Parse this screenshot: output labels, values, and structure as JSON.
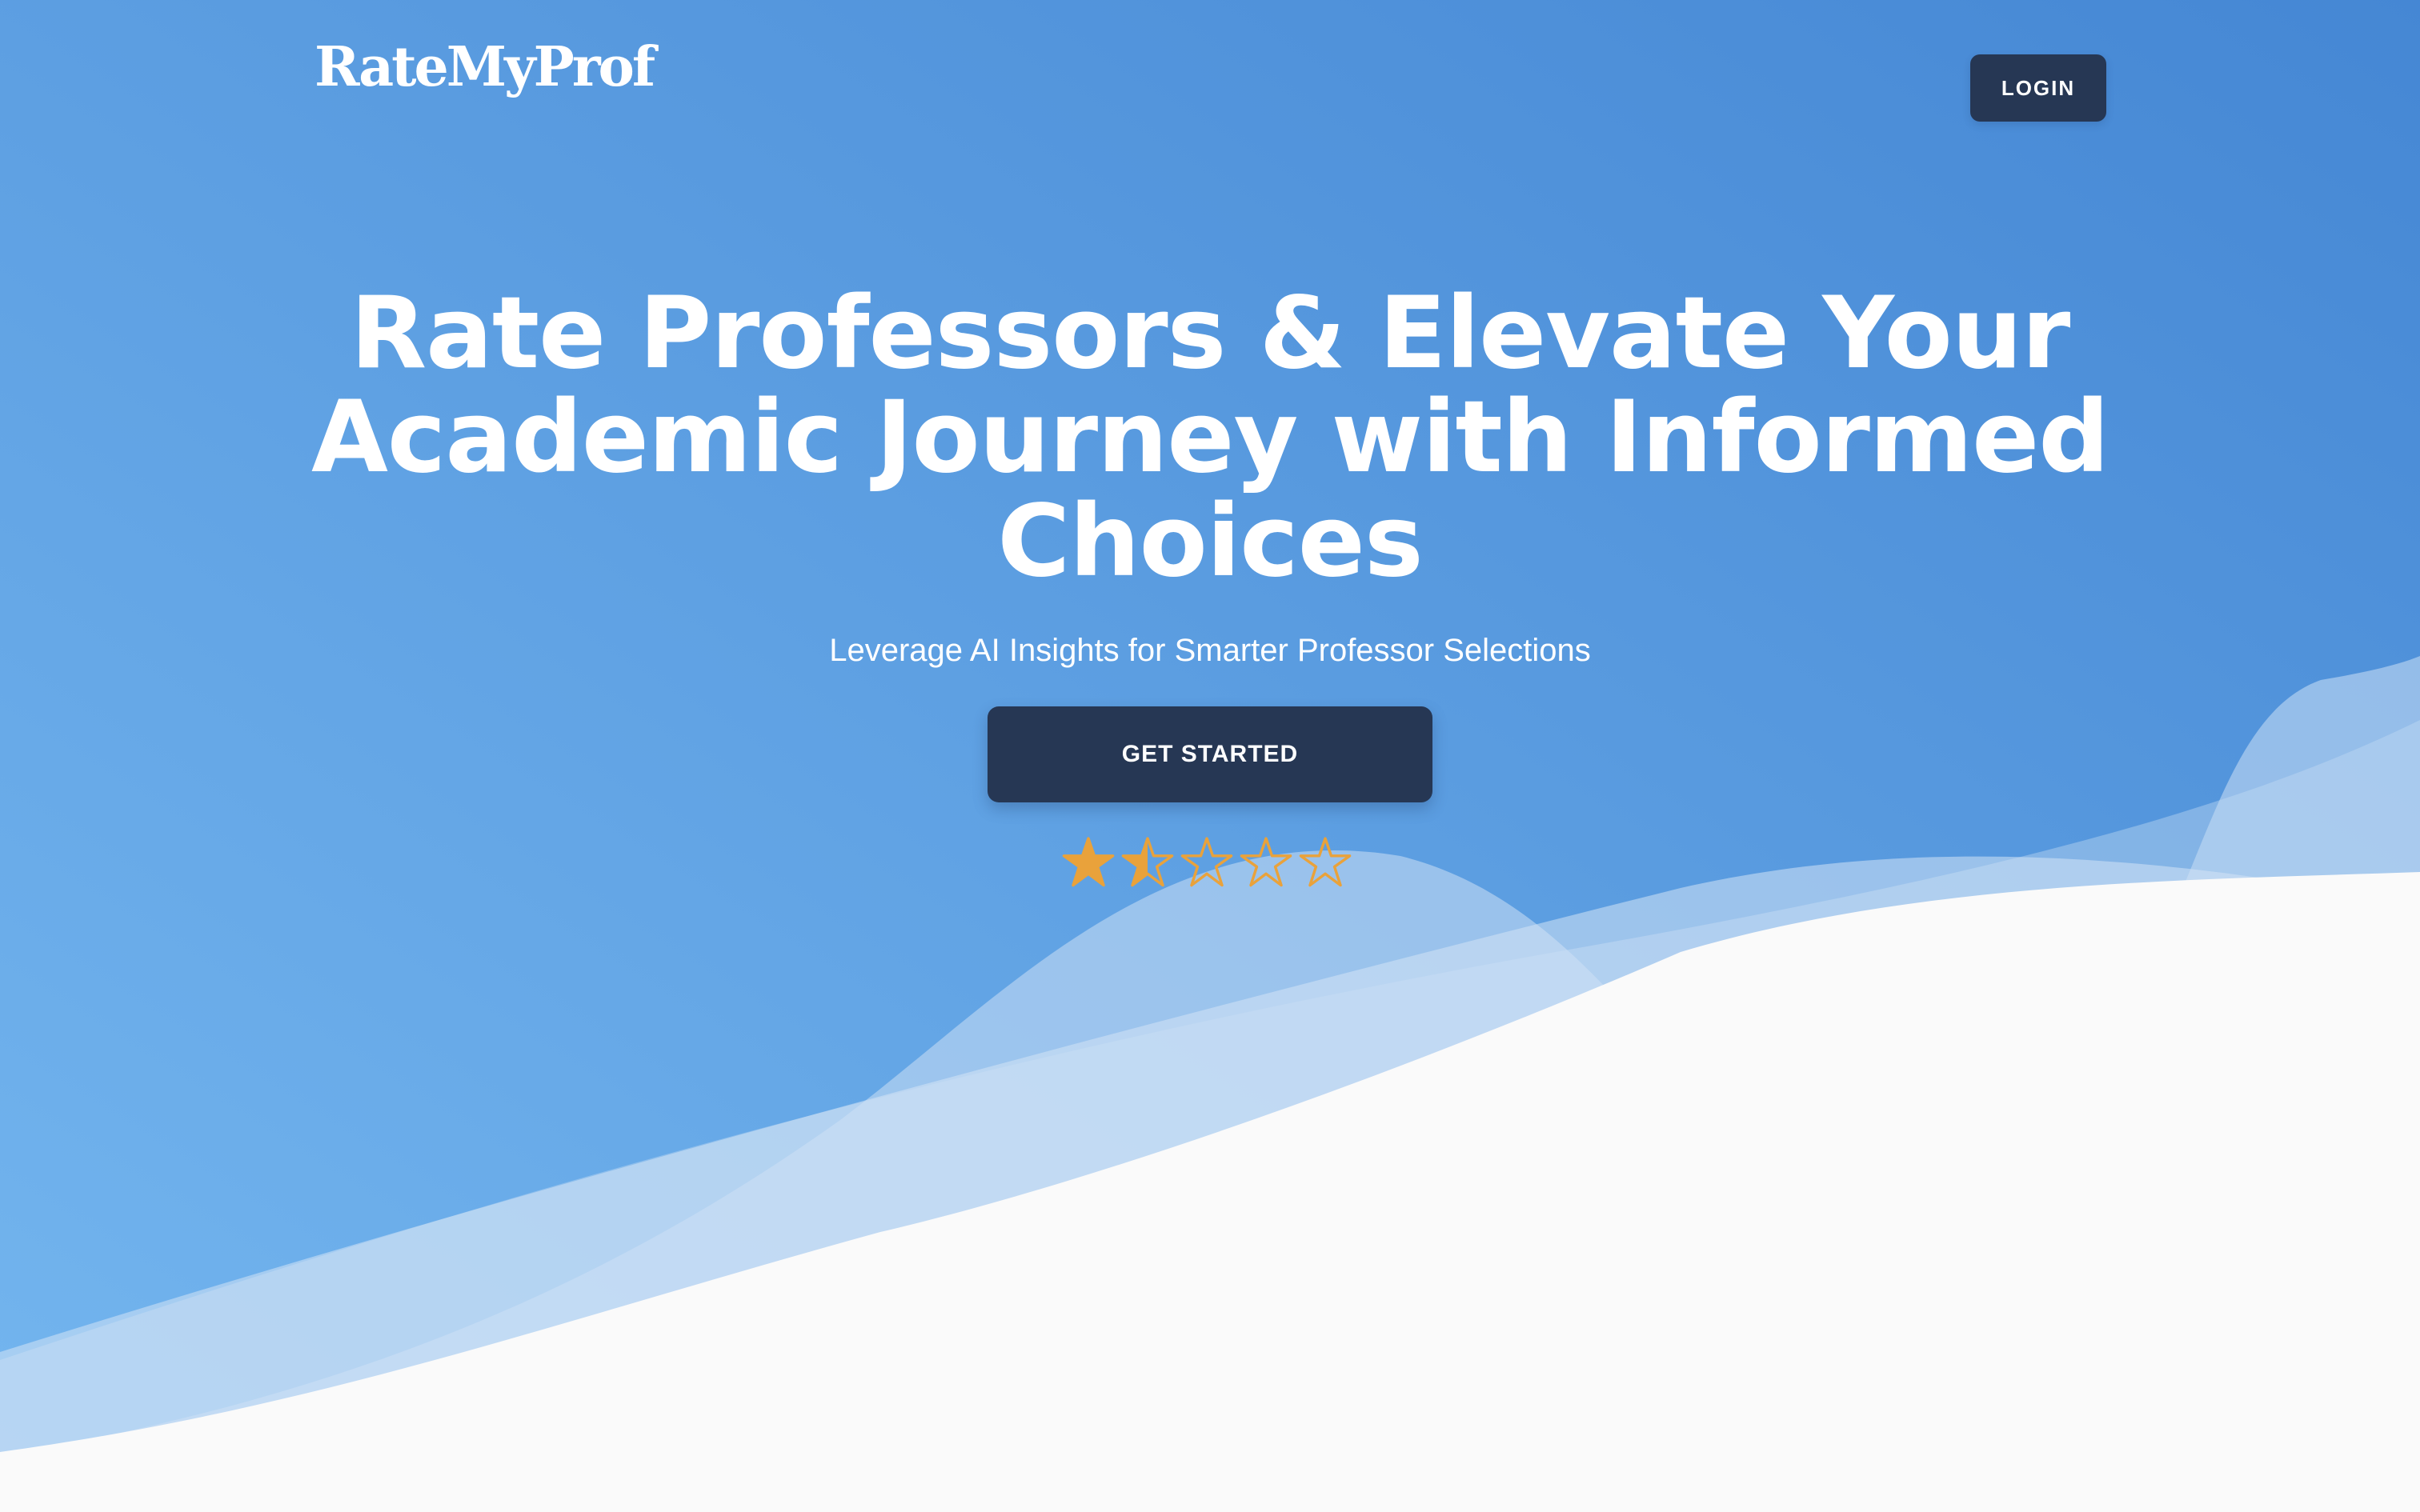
{
  "app": {
    "logo_text": "RateMyProf"
  },
  "header": {
    "login_label": "LOGIN"
  },
  "hero": {
    "headline": "Rate Professors & Elevate Your Academic Journey with Informed Choices",
    "subtitle": "Leverage AI Insights for Smarter Professor Selections",
    "cta_label": "GET STARTED"
  },
  "rating": {
    "value": 1.5,
    "max": 5,
    "star_color": "#e9a23b",
    "icon": "star-icon"
  },
  "colors": {
    "gradient_start": "#74b6ef",
    "gradient_end": "#4587d4",
    "button_dark": "#263754",
    "page_background": "#fafafa"
  }
}
